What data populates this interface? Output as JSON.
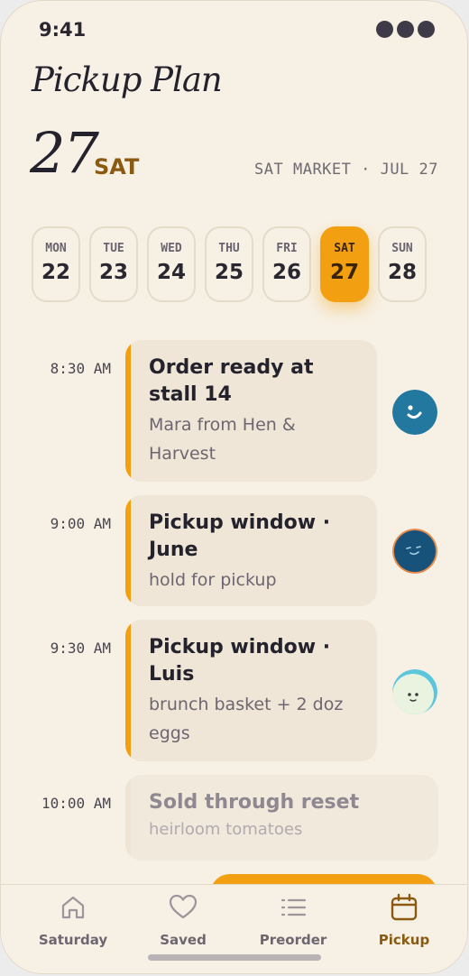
{
  "status": {
    "time": "9:41"
  },
  "header": {
    "title": "Pickup Plan",
    "day_number": "27",
    "day_of_week": "SAT",
    "market_label": "SAT MARKET · JUL 27"
  },
  "week": [
    {
      "dow": "MON",
      "num": "22"
    },
    {
      "dow": "TUE",
      "num": "23"
    },
    {
      "dow": "WED",
      "num": "24"
    },
    {
      "dow": "THU",
      "num": "25"
    },
    {
      "dow": "FRI",
      "num": "26"
    },
    {
      "dow": "SAT",
      "num": "27",
      "selected": true
    },
    {
      "dow": "SUN",
      "num": "28"
    }
  ],
  "events": [
    {
      "time": "8:30 AM",
      "title": "Order ready at stall 14",
      "subtitle": "Mara from Hen & Harvest",
      "avatar": "mara-avatar"
    },
    {
      "time": "9:00 AM",
      "title": "Pickup window · June",
      "subtitle": "hold for pickup",
      "avatar": "june-avatar"
    },
    {
      "time": "9:30 AM",
      "title": "Pickup window · Luis",
      "subtitle": "brunch basket + 2 doz eggs",
      "avatar": "luis-avatar"
    },
    {
      "time": "10:00 AM",
      "title": "Sold through reset",
      "subtitle": "heirloom tomatoes",
      "faded": true
    }
  ],
  "tabs": [
    {
      "label": "Saturday",
      "icon": "home-icon"
    },
    {
      "label": "Saved",
      "icon": "heart-icon"
    },
    {
      "label": "Preorder",
      "icon": "list-icon"
    },
    {
      "label": "Pickup",
      "icon": "calendar-icon",
      "active": true
    }
  ],
  "colors": {
    "accent": "#f2a012",
    "background": "#f7f0e4",
    "card": "#efe6d7",
    "active_tab": "#8a5a10"
  }
}
